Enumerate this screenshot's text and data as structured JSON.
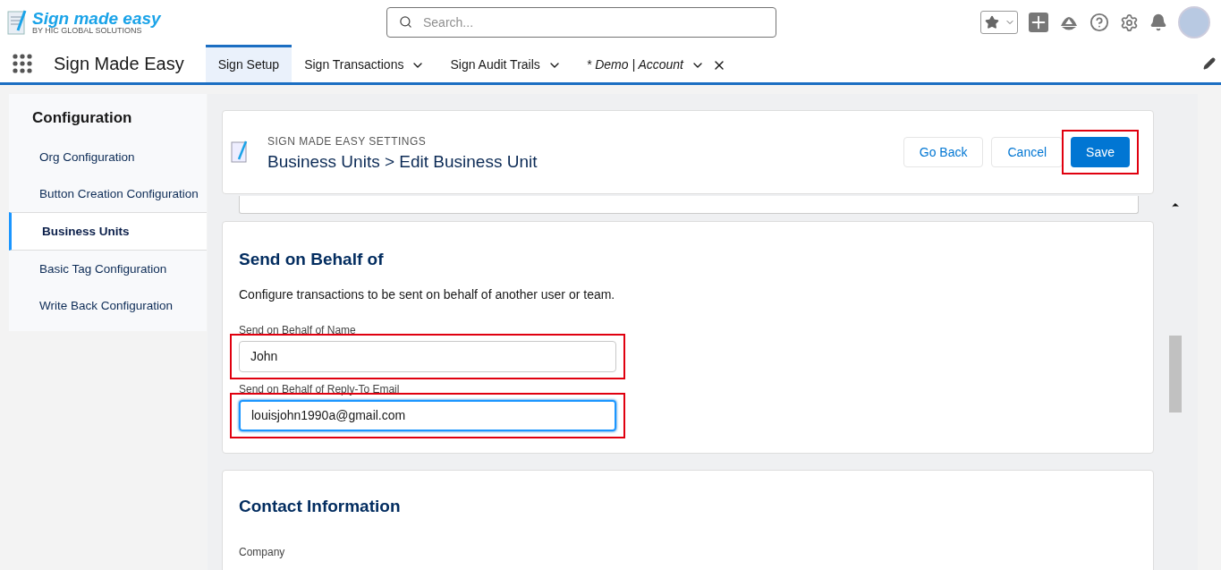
{
  "header": {
    "logo_title": "Sign made easy",
    "logo_subtitle": "BY HIC GLOBAL SOLUTIONS",
    "search": {
      "placeholder": "Search..."
    }
  },
  "nav": {
    "app_name": "Sign Made Easy",
    "tabs": [
      {
        "label": "Sign Setup",
        "selected": true,
        "dropdown": false,
        "italic": false,
        "closable": false
      },
      {
        "label": "Sign Transactions",
        "selected": false,
        "dropdown": true,
        "italic": false,
        "closable": false
      },
      {
        "label": "Sign Audit Trails",
        "selected": false,
        "dropdown": true,
        "italic": false,
        "closable": false
      },
      {
        "label": "* Demo | Account",
        "selected": false,
        "dropdown": true,
        "italic": true,
        "closable": true
      }
    ]
  },
  "sidebar": {
    "title": "Configuration",
    "items": [
      {
        "label": "Org Configuration",
        "selected": false
      },
      {
        "label": "Button Creation Configuration",
        "selected": false
      },
      {
        "label": "Business Units",
        "selected": true
      },
      {
        "label": "Basic Tag Configuration",
        "selected": false
      },
      {
        "label": "Write Back Configuration",
        "selected": false
      }
    ]
  },
  "page_header": {
    "eyebrow": "SIGN MADE EASY SETTINGS",
    "title": "Business Units > Edit Business Unit",
    "buttons": [
      {
        "label": "Go Back",
        "kind": "neutral",
        "highlighted": false
      },
      {
        "label": "Cancel",
        "kind": "neutral",
        "highlighted": false
      },
      {
        "label": "Save",
        "kind": "brand",
        "highlighted": true
      }
    ]
  },
  "send_on_behalf": {
    "title": "Send on Behalf of",
    "description": "Configure transactions to be sent on behalf of another user or team.",
    "fields": [
      {
        "label": "Send on Behalf of Name",
        "value": "John",
        "focused": false,
        "highlighted": true
      },
      {
        "label": "Send on Behalf of Reply-To Email",
        "value": "louisjohn1990a@gmail.com",
        "focused": true,
        "highlighted": true
      }
    ]
  },
  "contact": {
    "title": "Contact Information",
    "fields": [
      {
        "label": "Company"
      }
    ]
  }
}
